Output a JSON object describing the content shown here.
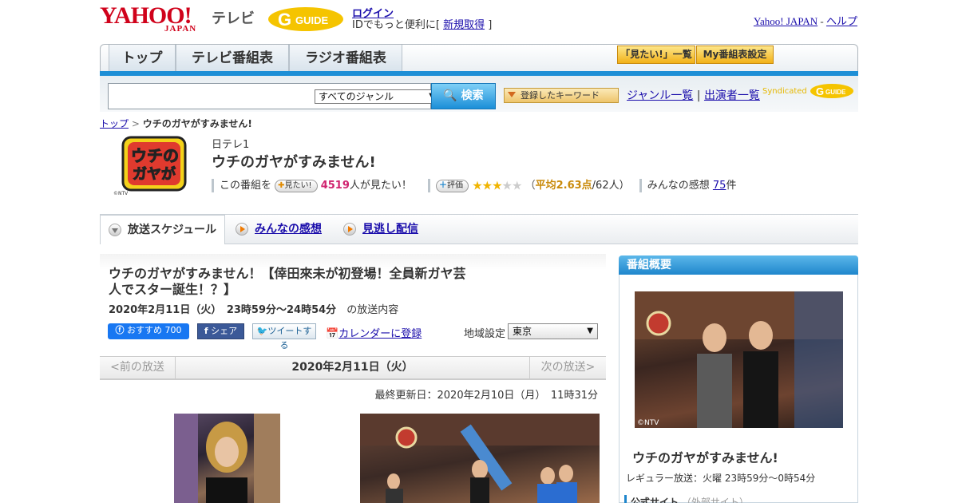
{
  "header": {
    "yahoo_logo": "YAHOO!",
    "yahoo_logo_sub": "JAPAN",
    "tv_label": "テレビ",
    "gguide_logo": "GUIDE",
    "login_link": "ログイン",
    "login_msg_prefix": "IDでもっと便利に[ ",
    "register_link": "新規取得",
    "login_msg_suffix": " ]",
    "yahoo_japan_link": "Yahoo! JAPAN",
    "separator": " - ",
    "help_link": "ヘルプ"
  },
  "nav": {
    "tabs": [
      "トップ",
      "テレビ番組表",
      "ラジオ番組表"
    ],
    "mitai_list": "「見たい!」一覧",
    "my_schedule": "My番組表設定"
  },
  "search": {
    "genre_selected": "すべてのジャンル",
    "search_button": "検索",
    "keyword_button": "登録したキーワード",
    "genre_list_link": "ジャンル一覧",
    "link_sep": " | ",
    "cast_list_link": "出演者一覧",
    "syndicated": "Syndicated"
  },
  "breadcrumb": {
    "top": "トップ",
    "sep": " > ",
    "current": "ウチのガヤがすみません!"
  },
  "program": {
    "channel": "日テレ1",
    "title": "ウチのガヤがすみません!",
    "mitai_prefix": "この番組を",
    "mitai_button": "見たい!",
    "mitai_count": "4519",
    "mitai_suffix": "人が見たい！",
    "rate_button": "評価",
    "stars": "★★★",
    "stars_off": "★★",
    "avg_open": "（",
    "avg_label": "平均2.63点",
    "avg_count": "/62人）",
    "impressions_label": "みんなの感想 ",
    "impressions_count": "75",
    "impressions_suffix": "件",
    "rating_value": 2.63,
    "logo_copyright": "©NTV"
  },
  "tabs": [
    {
      "label": "放送スケジュール",
      "active": true
    },
    {
      "label": "みんなの感想",
      "active": false
    },
    {
      "label": "見逃し配信",
      "active": false
    }
  ],
  "episode": {
    "title": "ウチのガヤがすみません！【倖田來未が初登場！全員新ガヤ芸人でスター誕生！？】",
    "date_time": "2020年2月11日（火）　23時59分～24時54分",
    "date_suffix": "の放送内容",
    "fb_recommend": "おすすめ 700",
    "fb_share": "シェア",
    "tweet": "ツイートする",
    "calendar": "カレンダーに登録",
    "region_label": "地域設定",
    "region_selected": "東京"
  },
  "datenav": {
    "prev": "<前の放送",
    "current": "2020年2月11日（火）",
    "next": "次の放送>"
  },
  "updated": "最終更新日：2020年2月10日（月）　11時31分",
  "sidebar": {
    "heading": "番組概要",
    "photo_copyright": "©NTV",
    "title": "ウチのガヤがすみません!",
    "regular": "レギュラー放送：火曜 23時59分～0時54分",
    "official_site": "公式サイト",
    "official_external": "（外部サイト）"
  }
}
